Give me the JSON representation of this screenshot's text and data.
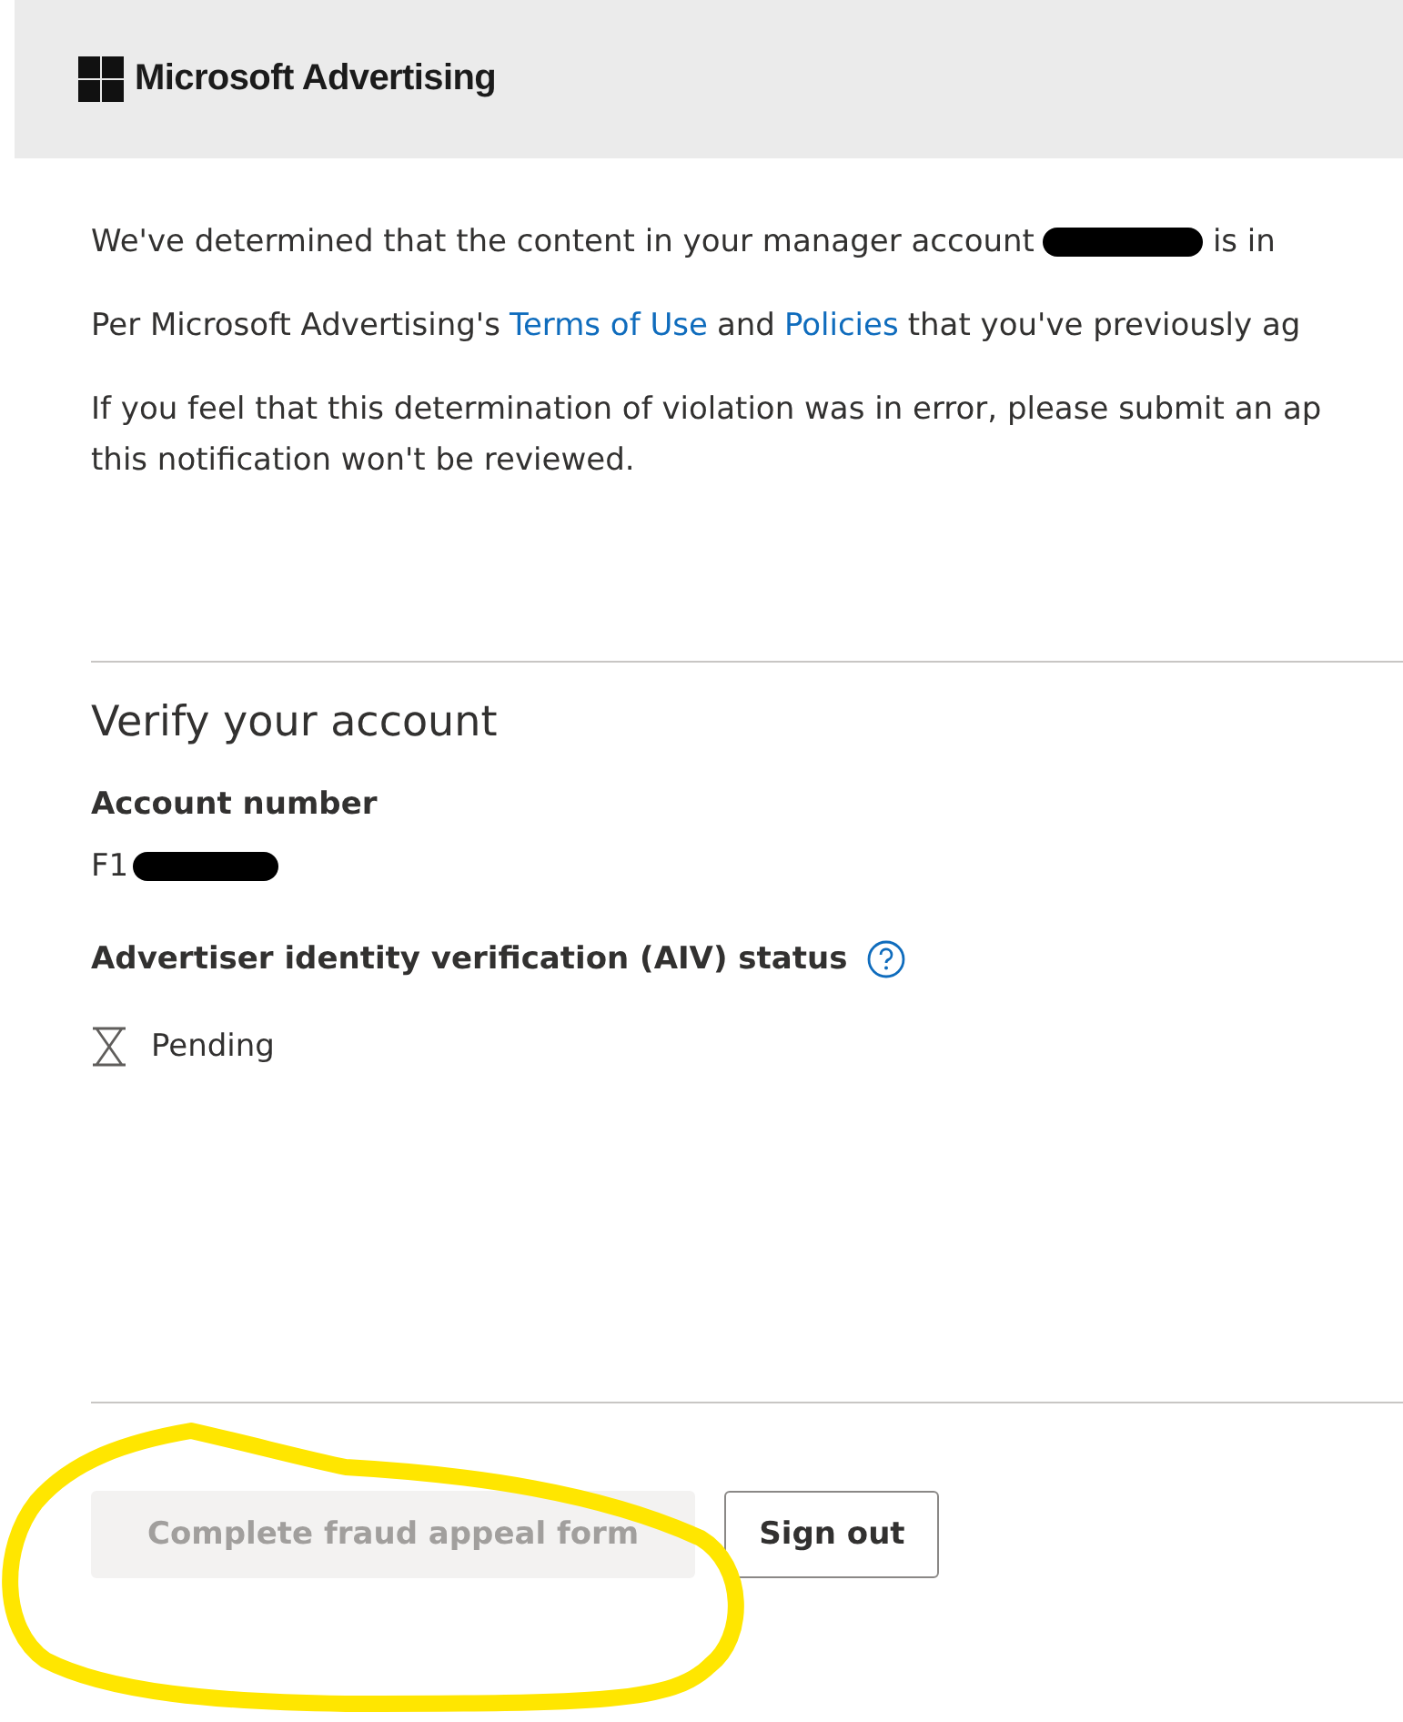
{
  "header": {
    "brand": "Microsoft Advertising"
  },
  "message": [
    {
      "segments": [
        {
          "kind": "text",
          "text": "We've determined that the content in your manager account"
        },
        {
          "kind": "redaction"
        },
        {
          "kind": "text",
          "text": "is in"
        }
      ]
    },
    {
      "segments": [
        {
          "kind": "text",
          "text": "Per Microsoft Advertising's"
        },
        {
          "kind": "link",
          "text": "Terms of Use"
        },
        {
          "kind": "text",
          "text": "and"
        },
        {
          "kind": "link",
          "text": "Policies"
        },
        {
          "kind": "text",
          "text": "that you've previously ag"
        }
      ]
    },
    {
      "segments": [
        {
          "kind": "text",
          "text": "If you feel that this determination of violation was in error, please submit an ap"
        }
      ]
    },
    {
      "segments": [
        {
          "kind": "text",
          "text": "this notification won't be reviewed."
        }
      ]
    }
  ],
  "verify": {
    "title": "Verify your account",
    "account_label": "Account number",
    "account_value": "F1",
    "account_redacted": true,
    "aiv_label": "Advertiser identity verification (AIV) status",
    "aiv_status": "Pending"
  },
  "buttons": [
    {
      "label": "Complete fraud appeal form",
      "kind": "primary",
      "disabled": true
    },
    {
      "label": "Sign out",
      "kind": "secondary",
      "disabled": false
    }
  ],
  "annotation": {
    "circle_drawn": true
  }
}
